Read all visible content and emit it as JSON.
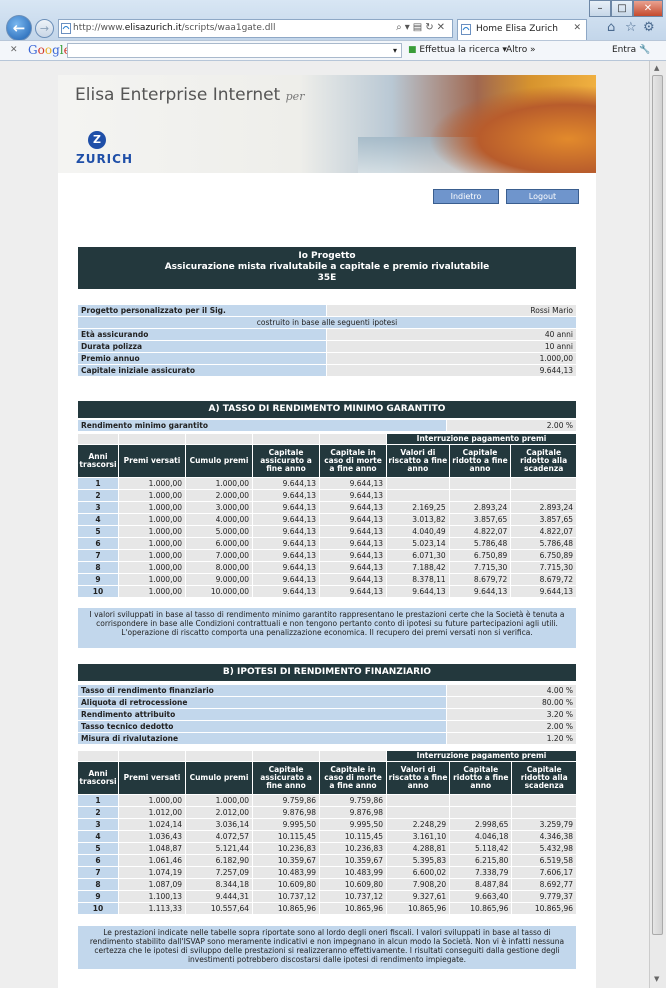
{
  "browser": {
    "url_prefix": "http://www.",
    "url_domain": "elisazurich.it",
    "url_path": "/scripts/waa1gate.dll",
    "tab_title": "Home Elisa Zurich",
    "google_label": "Google",
    "search_button": "Effettua la ricerca",
    "more_label": "Altro »",
    "signin_label": "Entra"
  },
  "header": {
    "site_title": "Elisa Enterprise Internet",
    "site_title_suffix": "per",
    "brand": "ZURICH",
    "back_label": "Indietro",
    "logout_label": "Logout"
  },
  "project": {
    "line1": "Io Progetto",
    "line2": "Assicurazione mista rivalutabile a capitale e premio rivalutabile",
    "line3": "35E"
  },
  "info": {
    "client_label": "Progetto personalizzato per il Sig.",
    "client_name": "Rossi Mario",
    "subtitle": "costruito in base alle seguenti ipotesi",
    "rows": [
      {
        "label": "Età assicurando",
        "value": "40 anni"
      },
      {
        "label": "Durata polizza",
        "value": "10 anni"
      },
      {
        "label": "Premio annuo",
        "value": "1.000,00"
      },
      {
        "label": "Capitale iniziale assicurato",
        "value": "9.644,13"
      }
    ]
  },
  "headers": {
    "group": "Interruzione pagamento premi",
    "cols": [
      "Anni trascorsi",
      "Premi versati",
      "Cumulo premi",
      "Capitale assicurato a fine anno",
      "Capitale in caso di morte a fine anno",
      "Valori di riscatto a fine anno",
      "Capitale ridotto a fine anno",
      "Capitale ridotto alla scadenza"
    ]
  },
  "sectionA": {
    "title": "A) TASSO DI RENDIMENTO MINIMO GARANTITO",
    "min_label": "Rendimento minimo garantito",
    "min_value": "2.00 %",
    "rows": [
      [
        "1",
        "1.000,00",
        "1.000,00",
        "9.644,13",
        "9.644,13",
        "",
        "",
        ""
      ],
      [
        "2",
        "1.000,00",
        "2.000,00",
        "9.644,13",
        "9.644,13",
        "",
        "",
        ""
      ],
      [
        "3",
        "1.000,00",
        "3.000,00",
        "9.644,13",
        "9.644,13",
        "2.169,25",
        "2.893,24",
        "2.893,24"
      ],
      [
        "4",
        "1.000,00",
        "4.000,00",
        "9.644,13",
        "9.644,13",
        "3.013,82",
        "3.857,65",
        "3.857,65"
      ],
      [
        "5",
        "1.000,00",
        "5.000,00",
        "9.644,13",
        "9.644,13",
        "4.040,49",
        "4.822,07",
        "4.822,07"
      ],
      [
        "6",
        "1.000,00",
        "6.000,00",
        "9.644,13",
        "9.644,13",
        "5.023,14",
        "5.786,48",
        "5.786,48"
      ],
      [
        "7",
        "1.000,00",
        "7.000,00",
        "9.644,13",
        "9.644,13",
        "6.071,30",
        "6.750,89",
        "6.750,89"
      ],
      [
        "8",
        "1.000,00",
        "8.000,00",
        "9.644,13",
        "9.644,13",
        "7.188,42",
        "7.715,30",
        "7.715,30"
      ],
      [
        "9",
        "1.000,00",
        "9.000,00",
        "9.644,13",
        "9.644,13",
        "8.378,11",
        "8.679,72",
        "8.679,72"
      ],
      [
        "10",
        "1.000,00",
        "10.000,00",
        "9.644,13",
        "9.644,13",
        "9.644,13",
        "9.644,13",
        "9.644,13"
      ]
    ],
    "note1": "I valori sviluppati in base al tasso di rendimento minimo garantito rappresentano le prestazioni certe che la Società è tenuta a corrispondere in base alle Condizioni contrattuali e non tengono pertanto conto di ipotesi su future partecipazioni agli utili.",
    "note2": "L'operazione di riscatto comporta una penalizzazione economica. Il recupero dei premi versati non si verifica."
  },
  "sectionB": {
    "title": "B) IPOTESI DI RENDIMENTO FINANZIARIO",
    "params": [
      {
        "label": "Tasso di rendimento finanziario",
        "value": "4.00 %"
      },
      {
        "label": "Aliquota di retrocessione",
        "value": "80.00 %"
      },
      {
        "label": "Rendimento attribuito",
        "value": "3.20 %"
      },
      {
        "label": "Tasso tecnico dedotto",
        "value": "2.00 %"
      },
      {
        "label": "Misura di rivalutazione",
        "value": "1.20 %"
      }
    ],
    "rows": [
      [
        "1",
        "1.000,00",
        "1.000,00",
        "9.759,86",
        "9.759,86",
        "",
        "",
        ""
      ],
      [
        "2",
        "1.012,00",
        "2.012,00",
        "9.876,98",
        "9.876,98",
        "",
        "",
        ""
      ],
      [
        "3",
        "1.024,14",
        "3.036,14",
        "9.995,50",
        "9.995,50",
        "2.248,29",
        "2.998,65",
        "3.259,79"
      ],
      [
        "4",
        "1.036,43",
        "4.072,57",
        "10.115,45",
        "10.115,45",
        "3.161,10",
        "4.046,18",
        "4.346,38"
      ],
      [
        "5",
        "1.048,87",
        "5.121,44",
        "10.236,83",
        "10.236,83",
        "4.288,81",
        "5.118,42",
        "5.432,98"
      ],
      [
        "6",
        "1.061,46",
        "6.182,90",
        "10.359,67",
        "10.359,67",
        "5.395,83",
        "6.215,80",
        "6.519,58"
      ],
      [
        "7",
        "1.074,19",
        "7.257,09",
        "10.483,99",
        "10.483,99",
        "6.600,02",
        "7.338,79",
        "7.606,17"
      ],
      [
        "8",
        "1.087,09",
        "8.344,18",
        "10.609,80",
        "10.609,80",
        "7.908,20",
        "8.487,84",
        "8.692,77"
      ],
      [
        "9",
        "1.100,13",
        "9.444,31",
        "10.737,12",
        "10.737,12",
        "9.327,61",
        "9.663,40",
        "9.779,37"
      ],
      [
        "10",
        "1.113,33",
        "10.557,64",
        "10.865,96",
        "10.865,96",
        "10.865,96",
        "10.865,96",
        "10.865,96"
      ]
    ],
    "note": "Le prestazioni indicate nelle tabelle sopra riportate sono al lordo degli oneri fiscali. I valori sviluppati in base al tasso di rendimento stabilito dall'ISVAP sono meramente indicativi e non impegnano in alcun modo la Società. Non vi è infatti nessuna certezza che le ipotesi di sviluppo delle prestazioni si realizzeranno effettivamente. I risultati conseguiti dalla gestione degli investimenti potrebbero discostarsi dalle ipotesi di rendimento impiegate."
  }
}
